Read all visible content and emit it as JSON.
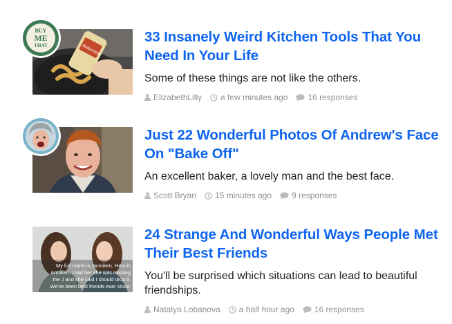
{
  "feed": {
    "items": [
      {
        "title": "33 Insanely Weird Kitchen Tools That You Need In Your Life",
        "description": "Some of these things are not like the others.",
        "author": "ElizabethLilly",
        "time": "a few minutes ago",
        "responses": "16 responses",
        "badge": {
          "line1": "BUY",
          "line2": "ME",
          "line3": "THAT",
          "color": "#3d7a53"
        },
        "thumb_label": "Bottomless"
      },
      {
        "title": "Just 22 Wonderful Photos Of Andrew's Face On \"Bake Off\"",
        "description": "An excellent baker, a lovely man and the best face.",
        "author": "Scott Bryan",
        "time": "15 minutes ago",
        "responses": "9 responses",
        "badge": {
          "type": "reaction-face",
          "color": "#7ab3c9"
        }
      },
      {
        "title": "24 Strange And Wonderful Ways People Met Their Best Friends",
        "description": "You'll be surprised which situations can lead to beautiful friendships.",
        "author": "Natalya Lobanova",
        "time": "a half hour ago",
        "responses": "16 responses",
        "thumb_caption": [
          "My full name is Janniken. Hers is",
          "Anniken. I told her she was missing",
          "the J and she said I should drop it.",
          "We've been best friends ever since."
        ]
      }
    ],
    "colors": {
      "link": "#0f65ef",
      "meta": "#8f8f8f",
      "text": "#222222"
    },
    "icons": {
      "author": "user-icon",
      "time": "clock-icon",
      "responses": "comment-icon"
    }
  }
}
